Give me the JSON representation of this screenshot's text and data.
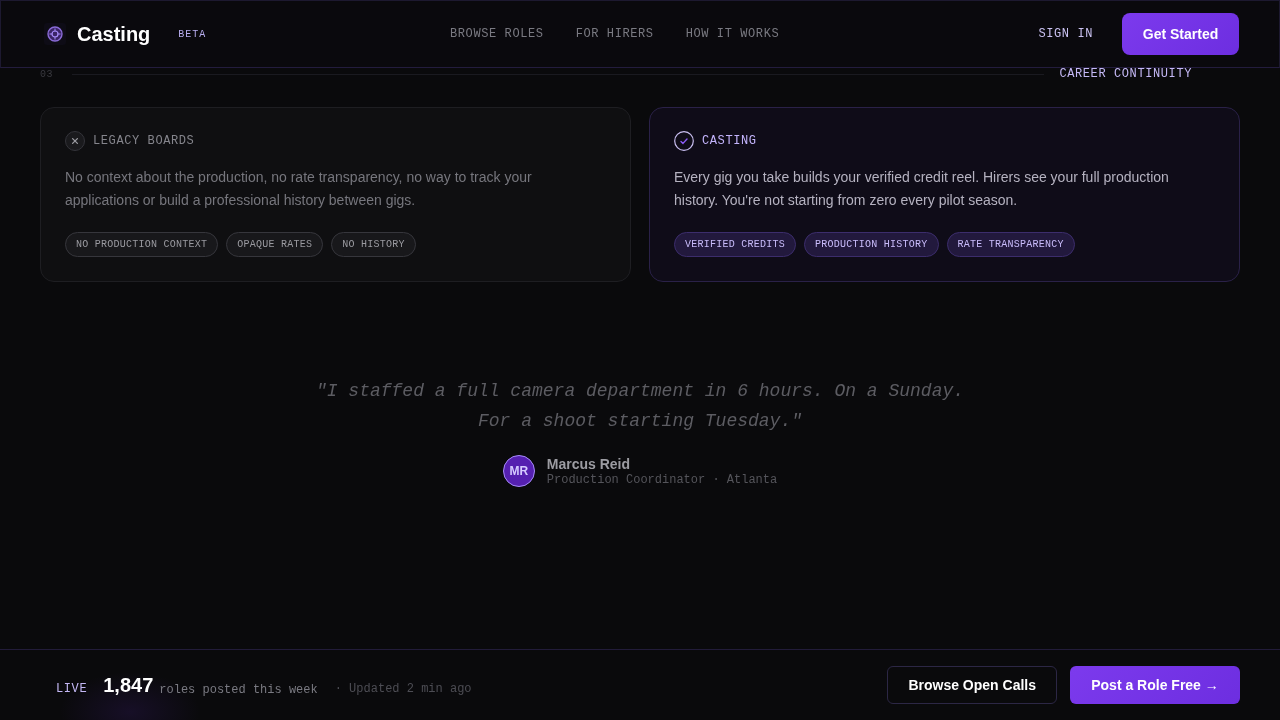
{
  "header": {
    "brand": "Casting",
    "badge": "BETA",
    "nav": [
      "BROWSE ROLES",
      "FOR HIRERS",
      "HOW IT WORKS"
    ],
    "sign_in": "SIGN IN",
    "cta": "Get Started"
  },
  "section": {
    "number": "03",
    "label": "CAREER CONTINUITY"
  },
  "comparison": [
    {
      "kind": "legacy",
      "title": "LEGACY BOARDS",
      "body": "No context about the production, no rate transparency, no way to track your applications or build a professional history between gigs.",
      "tags": [
        "NO PRODUCTION CONTEXT",
        "OPAQUE RATES",
        "NO HISTORY"
      ]
    },
    {
      "kind": "casting",
      "title": "CASTING",
      "body": "Every gig you take builds your verified credit reel. Hirers see your full production history. You're not starting from zero every pilot season.",
      "tags": [
        "VERIFIED CREDITS",
        "PRODUCTION HISTORY",
        "RATE TRANSPARENCY"
      ]
    }
  ],
  "testimonial": {
    "quote": "\"I staffed a full camera department in 6 hours. On a Sunday. For a shoot starting Tuesday.\"",
    "initials": "MR",
    "name": "Marcus Reid",
    "role": "Production Coordinator · Atlanta"
  },
  "status_bar": {
    "live": "LIVE",
    "count": "1,847",
    "count_label": "roles posted this week",
    "updated": "· Updated 2 min ago",
    "buttons": [
      {
        "kind": "secondary",
        "label": "Browse Open Calls"
      },
      {
        "kind": "primary",
        "label": "Post a Role Free →"
      }
    ]
  }
}
